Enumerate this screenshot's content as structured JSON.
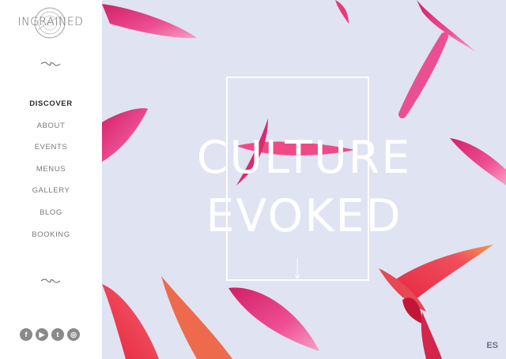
{
  "brand": {
    "logo_text": "INGRAINED"
  },
  "nav": {
    "items": [
      {
        "label": "DISCOVER",
        "active": true
      },
      {
        "label": "ABOUT",
        "active": false
      },
      {
        "label": "EVENTS",
        "active": false
      },
      {
        "label": "MENUS",
        "active": false
      },
      {
        "label": "GALLERY",
        "active": false
      },
      {
        "label": "BLOG",
        "active": false
      },
      {
        "label": "BOOKING",
        "active": false
      }
    ]
  },
  "social": {
    "icons": [
      "facebook-icon",
      "youtube-icon",
      "twitter-icon",
      "instagram-icon"
    ]
  },
  "hero": {
    "headline_line1": "CULTURE",
    "headline_line2": "EVOKED",
    "background_color": "#dfe3f2"
  },
  "language": {
    "label": "ES"
  },
  "colors": {
    "petal_pink": "#ec3f86",
    "petal_red": "#ef3b52",
    "accent_gold": "#f08a3a"
  }
}
